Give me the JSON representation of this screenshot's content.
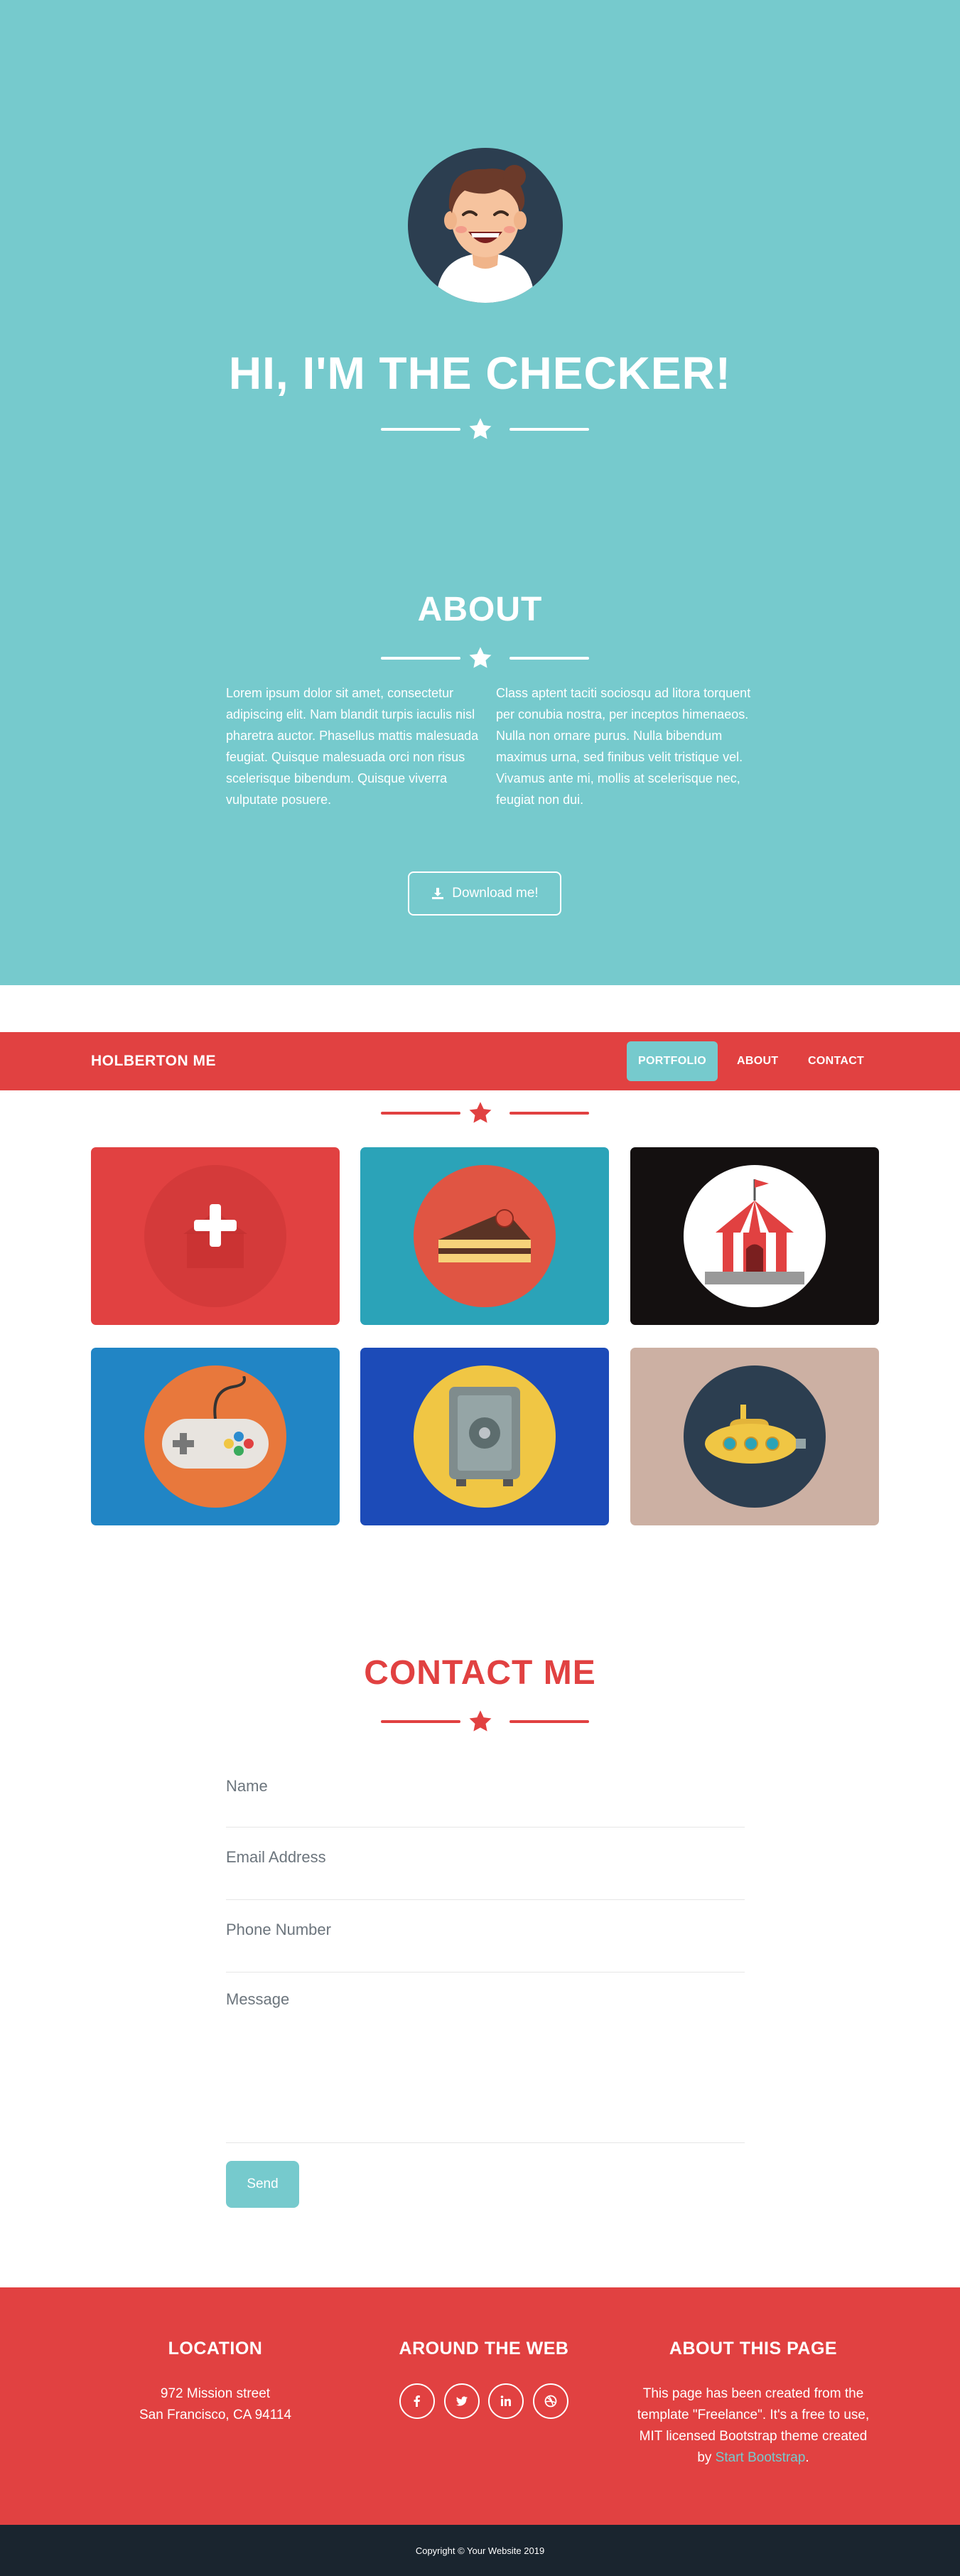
{
  "hero": {
    "title": "HI, I'M THE CHECKER!"
  },
  "about": {
    "title": "ABOUT",
    "left_text": "Lorem ipsum dolor sit amet, consectetur adipiscing elit. Nam blandit turpis iaculis nisl pharetra auctor. Phasellus mattis malesuada feugiat. Quisque malesuada orci non risus scelerisque bibendum. Quisque viverra vulputate posuere.",
    "right_text": "Class aptent taciti sociosqu ad litora torquent per conubia nostra, per inceptos himenaeos. Nulla non ornare purus. Nulla bibendum maximus urna, sed finibus velit tristique vel. Vivamus ante mi, mollis at scelerisque nec, feugiat non dui.",
    "download_label": "Download me!"
  },
  "navbar": {
    "brand": "HOLBERTON ME",
    "items": [
      {
        "label": "PORTFOLIO",
        "active": true
      },
      {
        "label": "ABOUT",
        "active": false
      },
      {
        "label": "CONTACT",
        "active": false
      }
    ]
  },
  "portfolio": {
    "items": [
      {
        "name": "cabin",
        "bg": "#e14141",
        "circle": "#e14141"
      },
      {
        "name": "cake",
        "bg": "#2ba3b8",
        "circle": "#e05543"
      },
      {
        "name": "circus",
        "bg": "#141010",
        "circle": "#ffffff"
      },
      {
        "name": "game",
        "bg": "#2185c5",
        "circle": "#e8783c"
      },
      {
        "name": "safe",
        "bg": "#1c4bb8",
        "circle": "#f0c644"
      },
      {
        "name": "submarine",
        "bg": "#ccb0a3",
        "circle": "#2c3e50"
      }
    ]
  },
  "contact": {
    "title": "CONTACT ME",
    "name_placeholder": "Name",
    "email_placeholder": "Email Address",
    "phone_placeholder": "Phone Number",
    "message_placeholder": "Message",
    "send_label": "Send"
  },
  "footer": {
    "location_title": "LOCATION",
    "location_line1": "972 Mission street",
    "location_line2": "San Francisco, CA 94114",
    "web_title": "AROUND THE WEB",
    "about_title": "ABOUT THIS PAGE",
    "about_text": "This page has been created from the template \"Freelance\". It's a free to use, MIT licensed Bootstrap theme created by",
    "about_link": "Start Bootstrap",
    "about_end": "."
  },
  "copyright": "Copyright © Your Website 2019",
  "colors": {
    "teal": "#76cacd",
    "red": "#e14141",
    "dark": "#1a252f"
  }
}
